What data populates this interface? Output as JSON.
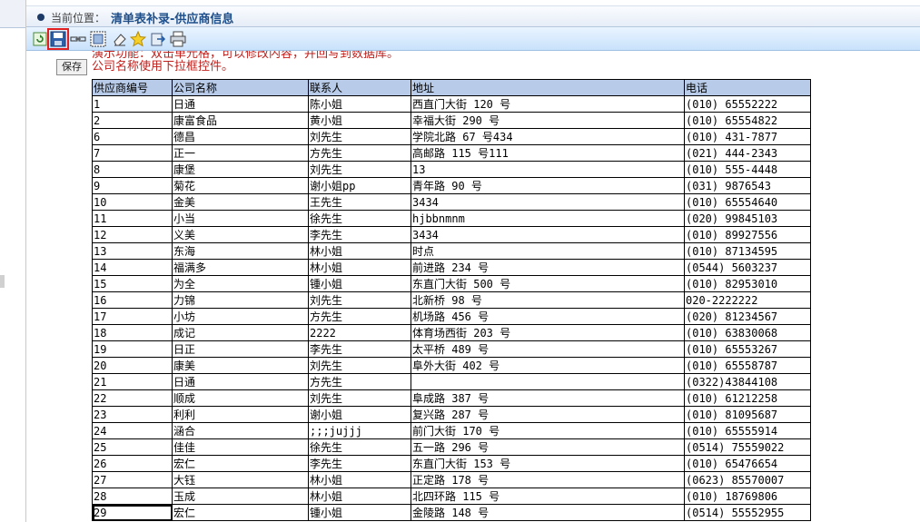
{
  "header": {
    "location_label": "当前位置：",
    "title": "清单表补录-供应商信息"
  },
  "toolbar": {
    "buttons": [
      {
        "icon": "refresh-icon"
      },
      {
        "icon": "save-icon"
      },
      {
        "icon": "link-icon"
      },
      {
        "icon": "select-all-icon"
      },
      {
        "icon": "eraser-icon"
      },
      {
        "icon": "star-icon"
      },
      {
        "icon": "export-icon"
      },
      {
        "icon": "print-icon"
      }
    ],
    "tooltip": "保存"
  },
  "info": {
    "line1": "演示功能：双击单元格，可以修改内容，并回写到数据库。",
    "line2": "公司名称使用下拉框控件。"
  },
  "table": {
    "columns": [
      "供应商编号",
      "公司名称",
      "联系人",
      "地址",
      "电话"
    ],
    "rows": [
      [
        "1",
        "日通",
        "陈小姐",
        "西直门大街 120 号",
        "(010) 65552222"
      ],
      [
        "2",
        "康富食品",
        "黄小姐",
        "幸福大街 290 号",
        "(010) 65554822"
      ],
      [
        "6",
        "德昌",
        "刘先生",
        "学院北路 67 号434",
        "(010) 431-7877"
      ],
      [
        "7",
        "正一",
        "方先生",
        "高邮路 115 号111",
        "(021) 444-2343"
      ],
      [
        "8",
        "康堡",
        "刘先生",
        "13",
        "(010) 555-4448"
      ],
      [
        "9",
        "菊花",
        "谢小姐pp",
        "青年路 90 号",
        "(031) 9876543"
      ],
      [
        "10",
        "金美",
        "王先生",
        "3434",
        "(010) 65554640"
      ],
      [
        "11",
        "小当",
        "徐先生",
        "hjbbnmnm",
        "(020) 99845103"
      ],
      [
        "12",
        "义美",
        "李先生",
        "3434",
        "(010) 89927556"
      ],
      [
        "13",
        "东海",
        "林小姐",
        "时点",
        "(010) 87134595"
      ],
      [
        "14",
        "福满多",
        "林小姐",
        "前进路 234 号",
        "(0544) 5603237"
      ],
      [
        "15",
        "为全",
        "锺小姐",
        "东直门大街 500 号",
        "(010) 82953010"
      ],
      [
        "16",
        "力锦",
        "刘先生",
        "北新桥 98 号",
        "020-2222222"
      ],
      [
        "17",
        "小坊",
        "方先生",
        "机场路 456 号",
        "(020) 81234567"
      ],
      [
        "18",
        "成记",
        "2222",
        "体育场西街 203 号",
        "(010) 63830068"
      ],
      [
        "19",
        "日正",
        "李先生",
        "太平桥 489 号",
        "(010) 65553267"
      ],
      [
        "20",
        "康美",
        "刘先生",
        "阜外大街 402 号",
        "(010) 65558787"
      ],
      [
        "21",
        "日通",
        "方先生",
        "",
        "(0322)43844108"
      ],
      [
        "22",
        "顺成",
        "刘先生",
        "阜成路 387 号",
        "(010) 61212258"
      ],
      [
        "23",
        "利利",
        "谢小姐",
        "复兴路 287 号",
        "(010) 81095687"
      ],
      [
        "24",
        "涵合",
        ";;;jujjj",
        "前门大街 170 号",
        "(010) 65555914"
      ],
      [
        "25",
        "佳佳",
        "徐先生",
        "五一路 296 号",
        "(0514) 75559022"
      ],
      [
        "26",
        "宏仁",
        "李先生",
        "东直门大街 153 号",
        "(010) 65476654"
      ],
      [
        "27",
        "大钰",
        "林小姐",
        "正定路 178 号",
        "(0623) 85570007"
      ],
      [
        "28",
        "玉成",
        "林小姐",
        "北四环路 115 号",
        "(010) 18769806"
      ],
      [
        "29",
        "宏仁",
        "锺小姐",
        "金陵路 148 号",
        "(0514) 55552955"
      ]
    ]
  },
  "colors": {
    "header_bg": "#b8cbe8",
    "info_text": "#c0201c",
    "title_text": "#1e4f8a",
    "highlight": "#e02020"
  }
}
